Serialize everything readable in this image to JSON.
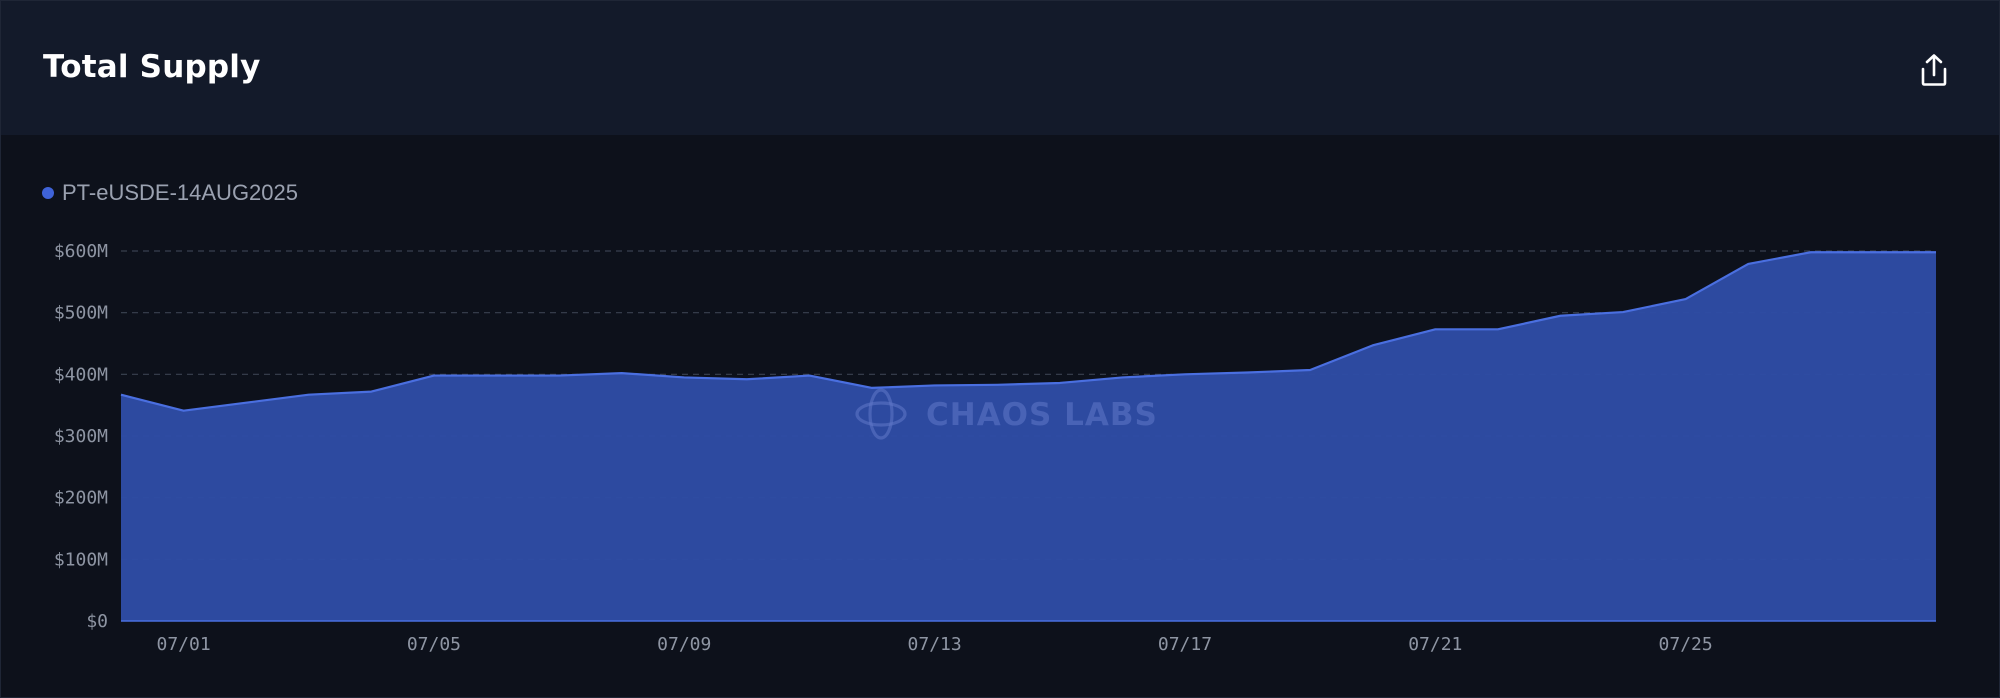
{
  "panel": {
    "title": "Total Supply",
    "export_icon": "share-upload-icon"
  },
  "watermark": {
    "text": "CHAOS LABS",
    "icon": "chaos-labs-logo-icon"
  },
  "colors": {
    "series": "#3f63d8",
    "area_fill": "#2e4ca5",
    "line": "#4a6fe0",
    "grid": "#3a4150",
    "background": "#0d111b",
    "header": "#131a2a"
  },
  "chart_data": {
    "type": "area",
    "legend_position": "top-left",
    "grid": true,
    "xlabel": "",
    "ylabel": "",
    "ylim": [
      0,
      600000000
    ],
    "y_ticks": [
      {
        "value": 0,
        "label": "$0"
      },
      {
        "value": 100000000,
        "label": "$100M"
      },
      {
        "value": 200000000,
        "label": "$200M"
      },
      {
        "value": 300000000,
        "label": "$300M"
      },
      {
        "value": 400000000,
        "label": "$400M"
      },
      {
        "value": 500000000,
        "label": "$500M"
      },
      {
        "value": 600000000,
        "label": "$600M"
      }
    ],
    "x_ticks": [
      "07/01",
      "07/05",
      "07/09",
      "07/13",
      "07/17",
      "07/21",
      "07/25"
    ],
    "x": [
      "06/30",
      "07/01",
      "07/02",
      "07/03",
      "07/04",
      "07/05",
      "07/06",
      "07/07",
      "07/08",
      "07/09",
      "07/10",
      "07/11",
      "07/12",
      "07/13",
      "07/14",
      "07/15",
      "07/16",
      "07/17",
      "07/18",
      "07/19",
      "07/20",
      "07/21",
      "07/22",
      "07/23",
      "07/24",
      "07/25",
      "07/26",
      "07/27",
      "07/28",
      "07/29"
    ],
    "series": [
      {
        "name": "PT-eUSDE-14AUG2025",
        "values": [
          367000000,
          341000000,
          354000000,
          367000000,
          372000000,
          398000000,
          398000000,
          398000000,
          402000000,
          395000000,
          392000000,
          398000000,
          378000000,
          382000000,
          383000000,
          386000000,
          395000000,
          400000000,
          403000000,
          407000000,
          447000000,
          473000000,
          473000000,
          495000000,
          501000000,
          522000000,
          579000000,
          598000000,
          598000000,
          598000000
        ]
      }
    ]
  }
}
